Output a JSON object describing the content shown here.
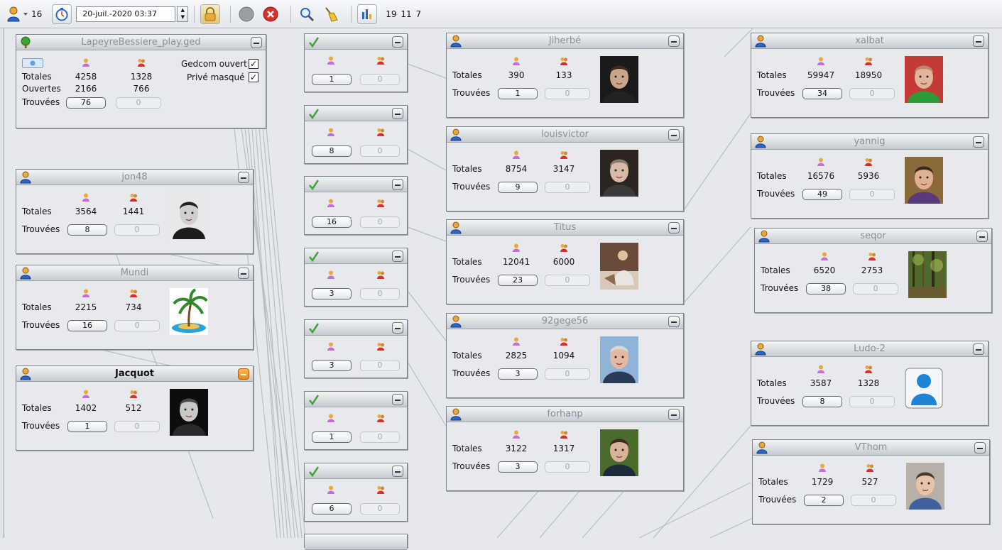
{
  "toolbar": {
    "user_count": "16",
    "date_value": "20-juil.-2020 03:37",
    "stats": "19 11 7",
    "colors": {
      "accent": "#2a66c9",
      "stop_red": "#d9302c",
      "lock_gold": "#e8a93a"
    }
  },
  "root_panel": {
    "title": "LapeyreBessiere_play.ged",
    "totales_label": "Totales",
    "ouvertes_label": "Ouvertes",
    "trouvees_label": "Trouvées",
    "totales_individus": "4258",
    "totales_familles": "1328",
    "ouvertes_individus": "2166",
    "ouvertes_familles": "766",
    "trouvees_individus": "76",
    "trouvees_familles": "0",
    "gedcom_ouvert_label": "Gedcom ouvert",
    "prive_masque_label": "Privé masqué",
    "check_mark": "✓"
  },
  "left_panels": [
    {
      "title": "jon48",
      "totales_label": "Totales",
      "trouvees_label": "Trouvées",
      "individus": "3564",
      "familles": "1441",
      "found": "8",
      "found_fam": "0",
      "photo": "portrait-bw-man",
      "active": false
    },
    {
      "title": "Mundi",
      "totales_label": "Totales",
      "trouvees_label": "Trouvées",
      "individus": "2215",
      "familles": "734",
      "found": "16",
      "found_fam": "0",
      "photo": "palm-island",
      "active": false
    },
    {
      "title": "Jacquot",
      "totales_label": "Totales",
      "trouvees_label": "Trouvées",
      "individus": "1402",
      "familles": "512",
      "found": "1",
      "found_fam": "0",
      "photo": "portrait-bw-elder",
      "active": true
    }
  ],
  "mid_panels": [
    {
      "found": "1",
      "found_fam": "0"
    },
    {
      "found": "8",
      "found_fam": "0"
    },
    {
      "found": "16",
      "found_fam": "0"
    },
    {
      "found": "3",
      "found_fam": "0"
    },
    {
      "found": "3",
      "found_fam": "0"
    },
    {
      "found": "1",
      "found_fam": "0"
    },
    {
      "found": "6",
      "found_fam": "0"
    }
  ],
  "center_panels": [
    {
      "title": "Jiherbé",
      "totales_label": "Totales",
      "trouvees_label": "Trouvées",
      "individus": "390",
      "familles": "133",
      "found": "1",
      "found_fam": "0",
      "photo": "portrait-dark-oval"
    },
    {
      "title": "louisvictor",
      "totales_label": "Totales",
      "trouvees_label": "Trouvées",
      "individus": "8754",
      "familles": "3147",
      "found": "9",
      "found_fam": "0",
      "photo": "portrait-elder-glasses"
    },
    {
      "title": "Titus",
      "totales_label": "Totales",
      "trouvees_label": "Trouvées",
      "individus": "12041",
      "familles": "6000",
      "found": "23",
      "found_fam": "0",
      "photo": "photo-seated"
    },
    {
      "title": "92gege56",
      "totales_label": "Totales",
      "trouvees_label": "Trouvées",
      "individus": "2825",
      "familles": "1094",
      "found": "3",
      "found_fam": "0",
      "photo": "portrait-sky"
    },
    {
      "title": "forhanp",
      "totales_label": "Totales",
      "trouvees_label": "Trouvées",
      "individus": "3122",
      "familles": "1317",
      "found": "3",
      "found_fam": "0",
      "photo": "portrait-green"
    }
  ],
  "right_panels": [
    {
      "title": "xalbat",
      "totales_label": "Totales",
      "trouvees_label": "Trouvées",
      "individus": "59947",
      "familles": "18950",
      "found": "34",
      "found_fam": "0",
      "photo": "portrait-green-shirt"
    },
    {
      "title": "yannig",
      "totales_label": "Totales",
      "trouvees_label": "Trouvées",
      "individus": "16576",
      "familles": "5936",
      "found": "49",
      "found_fam": "0",
      "photo": "portrait-glasses-warm"
    },
    {
      "title": "seqor",
      "totales_label": "Totales",
      "trouvees_label": "Trouvées",
      "individus": "6520",
      "familles": "2753",
      "found": "38",
      "found_fam": "0",
      "photo": "forest"
    },
    {
      "title": "Ludo-2",
      "totales_label": "Totales",
      "trouvees_label": "Trouvées",
      "individus": "3587",
      "familles": "1328",
      "found": "8",
      "found_fam": "0",
      "photo": "default-avatar"
    },
    {
      "title": "VThom",
      "totales_label": "Totales",
      "trouvees_label": "Trouvées",
      "individus": "1729",
      "familles": "527",
      "found": "2",
      "found_fam": "0",
      "photo": "portrait-child"
    }
  ]
}
